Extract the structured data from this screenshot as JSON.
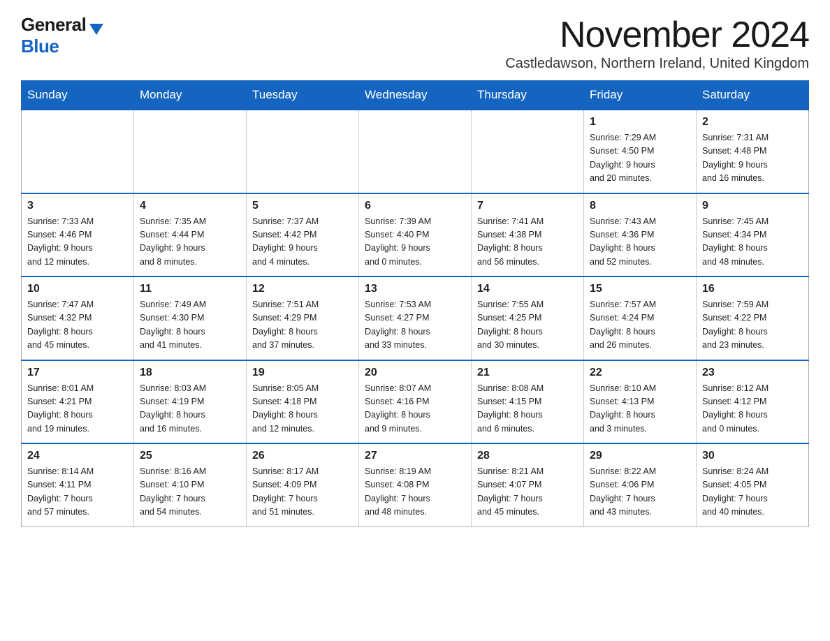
{
  "logo": {
    "general": "General",
    "blue": "Blue"
  },
  "header": {
    "month_title": "November 2024",
    "subtitle": "Castledawson, Northern Ireland, United Kingdom"
  },
  "days_of_week": [
    "Sunday",
    "Monday",
    "Tuesday",
    "Wednesday",
    "Thursday",
    "Friday",
    "Saturday"
  ],
  "weeks": [
    [
      {
        "day": "",
        "info": ""
      },
      {
        "day": "",
        "info": ""
      },
      {
        "day": "",
        "info": ""
      },
      {
        "day": "",
        "info": ""
      },
      {
        "day": "",
        "info": ""
      },
      {
        "day": "1",
        "info": "Sunrise: 7:29 AM\nSunset: 4:50 PM\nDaylight: 9 hours\nand 20 minutes."
      },
      {
        "day": "2",
        "info": "Sunrise: 7:31 AM\nSunset: 4:48 PM\nDaylight: 9 hours\nand 16 minutes."
      }
    ],
    [
      {
        "day": "3",
        "info": "Sunrise: 7:33 AM\nSunset: 4:46 PM\nDaylight: 9 hours\nand 12 minutes."
      },
      {
        "day": "4",
        "info": "Sunrise: 7:35 AM\nSunset: 4:44 PM\nDaylight: 9 hours\nand 8 minutes."
      },
      {
        "day": "5",
        "info": "Sunrise: 7:37 AM\nSunset: 4:42 PM\nDaylight: 9 hours\nand 4 minutes."
      },
      {
        "day": "6",
        "info": "Sunrise: 7:39 AM\nSunset: 4:40 PM\nDaylight: 9 hours\nand 0 minutes."
      },
      {
        "day": "7",
        "info": "Sunrise: 7:41 AM\nSunset: 4:38 PM\nDaylight: 8 hours\nand 56 minutes."
      },
      {
        "day": "8",
        "info": "Sunrise: 7:43 AM\nSunset: 4:36 PM\nDaylight: 8 hours\nand 52 minutes."
      },
      {
        "day": "9",
        "info": "Sunrise: 7:45 AM\nSunset: 4:34 PM\nDaylight: 8 hours\nand 48 minutes."
      }
    ],
    [
      {
        "day": "10",
        "info": "Sunrise: 7:47 AM\nSunset: 4:32 PM\nDaylight: 8 hours\nand 45 minutes."
      },
      {
        "day": "11",
        "info": "Sunrise: 7:49 AM\nSunset: 4:30 PM\nDaylight: 8 hours\nand 41 minutes."
      },
      {
        "day": "12",
        "info": "Sunrise: 7:51 AM\nSunset: 4:29 PM\nDaylight: 8 hours\nand 37 minutes."
      },
      {
        "day": "13",
        "info": "Sunrise: 7:53 AM\nSunset: 4:27 PM\nDaylight: 8 hours\nand 33 minutes."
      },
      {
        "day": "14",
        "info": "Sunrise: 7:55 AM\nSunset: 4:25 PM\nDaylight: 8 hours\nand 30 minutes."
      },
      {
        "day": "15",
        "info": "Sunrise: 7:57 AM\nSunset: 4:24 PM\nDaylight: 8 hours\nand 26 minutes."
      },
      {
        "day": "16",
        "info": "Sunrise: 7:59 AM\nSunset: 4:22 PM\nDaylight: 8 hours\nand 23 minutes."
      }
    ],
    [
      {
        "day": "17",
        "info": "Sunrise: 8:01 AM\nSunset: 4:21 PM\nDaylight: 8 hours\nand 19 minutes."
      },
      {
        "day": "18",
        "info": "Sunrise: 8:03 AM\nSunset: 4:19 PM\nDaylight: 8 hours\nand 16 minutes."
      },
      {
        "day": "19",
        "info": "Sunrise: 8:05 AM\nSunset: 4:18 PM\nDaylight: 8 hours\nand 12 minutes."
      },
      {
        "day": "20",
        "info": "Sunrise: 8:07 AM\nSunset: 4:16 PM\nDaylight: 8 hours\nand 9 minutes."
      },
      {
        "day": "21",
        "info": "Sunrise: 8:08 AM\nSunset: 4:15 PM\nDaylight: 8 hours\nand 6 minutes."
      },
      {
        "day": "22",
        "info": "Sunrise: 8:10 AM\nSunset: 4:13 PM\nDaylight: 8 hours\nand 3 minutes."
      },
      {
        "day": "23",
        "info": "Sunrise: 8:12 AM\nSunset: 4:12 PM\nDaylight: 8 hours\nand 0 minutes."
      }
    ],
    [
      {
        "day": "24",
        "info": "Sunrise: 8:14 AM\nSunset: 4:11 PM\nDaylight: 7 hours\nand 57 minutes."
      },
      {
        "day": "25",
        "info": "Sunrise: 8:16 AM\nSunset: 4:10 PM\nDaylight: 7 hours\nand 54 minutes."
      },
      {
        "day": "26",
        "info": "Sunrise: 8:17 AM\nSunset: 4:09 PM\nDaylight: 7 hours\nand 51 minutes."
      },
      {
        "day": "27",
        "info": "Sunrise: 8:19 AM\nSunset: 4:08 PM\nDaylight: 7 hours\nand 48 minutes."
      },
      {
        "day": "28",
        "info": "Sunrise: 8:21 AM\nSunset: 4:07 PM\nDaylight: 7 hours\nand 45 minutes."
      },
      {
        "day": "29",
        "info": "Sunrise: 8:22 AM\nSunset: 4:06 PM\nDaylight: 7 hours\nand 43 minutes."
      },
      {
        "day": "30",
        "info": "Sunrise: 8:24 AM\nSunset: 4:05 PM\nDaylight: 7 hours\nand 40 minutes."
      }
    ]
  ]
}
